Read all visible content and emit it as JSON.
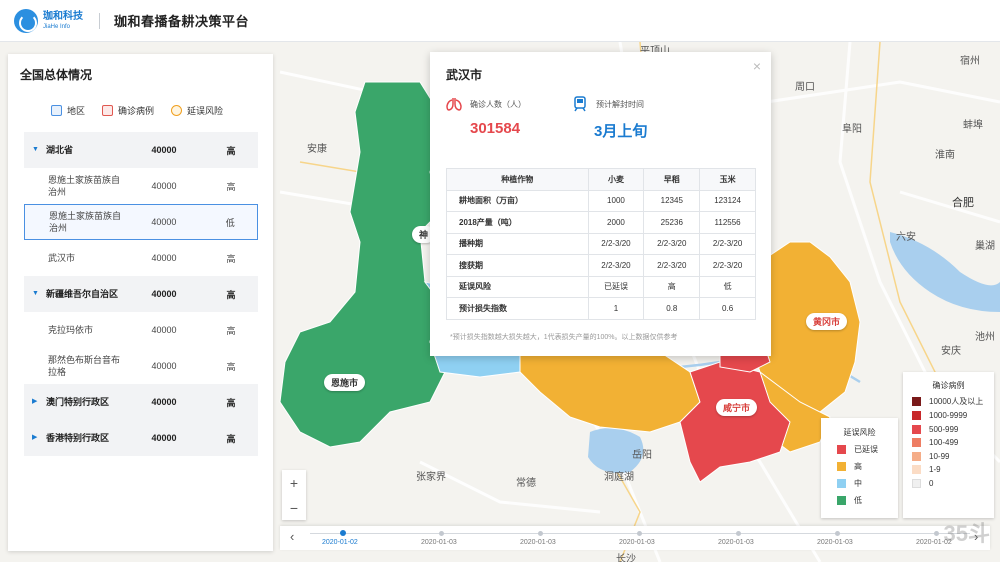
{
  "header": {
    "logo_cn": "珈和科技",
    "logo_en": "JiaHe Info",
    "title": "珈和春播备耕决策平台"
  },
  "left_panel": {
    "title": "全国总体情况",
    "legend": [
      "地区",
      "确诊病例",
      "延误风险"
    ],
    "rows": [
      {
        "type": "group",
        "name": "湖北省",
        "count": "40000",
        "risk": "高"
      },
      {
        "type": "item",
        "name": "恩施土家族苗族自治州",
        "count": "40000",
        "risk": "高"
      },
      {
        "type": "item",
        "name": "恩施土家族苗族自治州",
        "count": "40000",
        "risk": "低",
        "selected": true
      },
      {
        "type": "item",
        "name": "武汉市",
        "count": "40000",
        "risk": "高"
      },
      {
        "type": "group",
        "name": "新疆维吾尔自治区",
        "count": "40000",
        "risk": "高"
      },
      {
        "type": "item",
        "name": "克拉玛依市",
        "count": "40000",
        "risk": "高"
      },
      {
        "type": "item",
        "name": "那然色布斯台音布拉格",
        "count": "40000",
        "risk": "高"
      },
      {
        "type": "group",
        "name": "澳门特别行政区",
        "count": "40000",
        "risk": "高"
      },
      {
        "type": "group",
        "name": "香港特别行政区",
        "count": "40000",
        "risk": "高"
      }
    ]
  },
  "popup": {
    "city": "武汉市",
    "close": "×",
    "cases_label": "确诊人数（人）",
    "cases_value": "301584",
    "unseal_label": "预计解封时间",
    "unseal_value": "3月上旬",
    "table_headers": [
      "种植作物",
      "小麦",
      "早稻",
      "玉米"
    ],
    "table_rows": [
      [
        "耕地面积（万亩）",
        "1000",
        "12345",
        "123124"
      ],
      [
        "2018产量（吨）",
        "2000",
        "25236",
        "112556"
      ],
      [
        "播种期",
        "2/2-3/20",
        "2/2-3/20",
        "2/2-3/20"
      ],
      [
        "搜获期",
        "2/2-3/20",
        "2/2-3/20",
        "2/2-3/20"
      ],
      [
        "延误风险",
        "已延误",
        "高",
        "低"
      ],
      [
        "预计损失指数",
        "1",
        "0.8",
        "0.6"
      ]
    ],
    "note": "*预计损失指数越大损失越大，1代表损失产量的100%。以上数据仅供参考"
  },
  "map": {
    "labels": [
      "平顶山",
      "周口",
      "宿州",
      "安康",
      "阜阳",
      "蚌埠",
      "淮南",
      "合肥",
      "六安",
      "安庆",
      "池州",
      "岳阳",
      "常德",
      "洞庭湖",
      "张家界",
      "长沙",
      "巢湖"
    ],
    "region_tags": [
      "恩施市",
      "咸宁市",
      "黄冈市",
      "神"
    ]
  },
  "zoom": {
    "in": "+",
    "out": "−"
  },
  "timeline": {
    "prev": "‹",
    "next": "›",
    "dates": [
      "2020-01-02",
      "2020-01-03",
      "2020-01-03",
      "2020-01-03",
      "2020-01-03",
      "2020-01-03",
      "2020-01-02"
    ],
    "active_index": 0
  },
  "risk_legend": {
    "title": "延误风险",
    "items": [
      {
        "label": "已延误",
        "color": "#e5484d"
      },
      {
        "label": "高",
        "color": "#f2b134"
      },
      {
        "label": "中",
        "color": "#8fd0f2"
      },
      {
        "label": "低",
        "color": "#3aa66a"
      }
    ]
  },
  "case_legend": {
    "title": "确诊病例",
    "items": [
      {
        "label": "10000人及以上",
        "color": "#7a1a1a"
      },
      {
        "label": "1000-9999",
        "color": "#c8282a"
      },
      {
        "label": "500-999",
        "color": "#e5484d"
      },
      {
        "label": "100-499",
        "color": "#ee7d63"
      },
      {
        "label": "10-99",
        "color": "#f5ad88"
      },
      {
        "label": "1-9",
        "color": "#fbdcc5"
      },
      {
        "label": "0",
        "color": "#f0f0f0"
      }
    ]
  },
  "watermark": "35斗"
}
